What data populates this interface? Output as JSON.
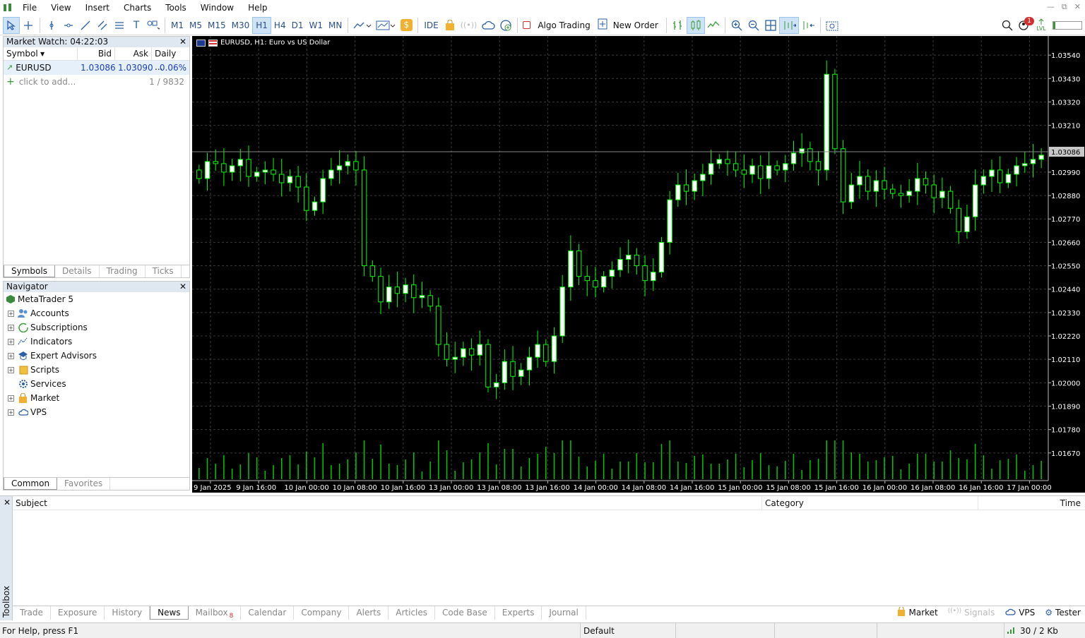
{
  "menu": {
    "items": [
      "File",
      "View",
      "Insert",
      "Charts",
      "Tools",
      "Window",
      "Help"
    ]
  },
  "toolbar": {
    "timeframes": [
      "M1",
      "M5",
      "M15",
      "M30",
      "H1",
      "H4",
      "D1",
      "W1",
      "MN"
    ],
    "active_timeframe": "H1",
    "ide_label": "IDE",
    "algo_trading_label": "Algo Trading",
    "new_order_label": "New Order",
    "alerts_count": "1",
    "lvl_label": "LVL"
  },
  "market_watch": {
    "title": "Market Watch: 04:22:03",
    "columns": [
      "Symbol",
      "Bid",
      "Ask",
      "Daily ..."
    ],
    "rows": [
      {
        "symbol": "EURUSD",
        "bid": "1.03086",
        "ask": "1.03090",
        "daily": "0.06%"
      }
    ],
    "add_label": "click to add...",
    "count_label": "1 / 9832",
    "tabs": [
      "Symbols",
      "Details",
      "Trading",
      "Ticks"
    ],
    "active_tab": "Symbols"
  },
  "navigator": {
    "title": "Navigator",
    "root": "MetaTrader 5",
    "items": [
      {
        "label": "Accounts",
        "icon": "accounts-icon",
        "expandable": true
      },
      {
        "label": "Subscriptions",
        "icon": "subscriptions-icon",
        "expandable": true
      },
      {
        "label": "Indicators",
        "icon": "indicators-icon",
        "expandable": true
      },
      {
        "label": "Expert Advisors",
        "icon": "expert-advisors-icon",
        "expandable": true
      },
      {
        "label": "Scripts",
        "icon": "scripts-icon",
        "expandable": true
      },
      {
        "label": "Services",
        "icon": "services-icon",
        "expandable": false
      },
      {
        "label": "Market",
        "icon": "market-icon",
        "expandable": true
      },
      {
        "label": "VPS",
        "icon": "vps-icon",
        "expandable": true
      }
    ],
    "tabs": [
      "Common",
      "Favorites"
    ],
    "active_tab": "Common"
  },
  "chart": {
    "title": "EURUSD, H1:  Euro vs US Dollar",
    "current_price_label": "1.03086"
  },
  "chart_data": {
    "type": "candlestick",
    "symbol": "EURUSD",
    "timeframe": "H1",
    "current_price": 1.03086,
    "y_ticks": [
      "1.03540",
      "1.03430",
      "1.03320",
      "1.03210",
      "1.02990",
      "1.02880",
      "1.02770",
      "1.02660",
      "1.02550",
      "1.02440",
      "1.02330",
      "1.02220",
      "1.02110",
      "1.02000",
      "1.01890",
      "1.01780",
      "1.01670"
    ],
    "ylim": [
      1.0154,
      1.0363
    ],
    "x_ticks": [
      "9 Jan 2025",
      "9 Jan 16:00",
      "10 Jan 00:00",
      "10 Jan 08:00",
      "10 Jan 16:00",
      "13 Jan 00:00",
      "13 Jan 08:00",
      "13 Jan 16:00",
      "14 Jan 00:00",
      "14 Jan 08:00",
      "14 Jan 16:00",
      "15 Jan 00:00",
      "15 Jan 08:00",
      "15 Jan 16:00",
      "16 Jan 00:00",
      "16 Jan 08:00",
      "16 Jan 16:00",
      "17 Jan 00:00"
    ],
    "closes": [
      1.0296,
      1.0304,
      1.0303,
      1.0299,
      1.0302,
      1.0305,
      1.0297,
      1.0299,
      1.03,
      1.0298,
      1.0294,
      1.0297,
      1.0292,
      1.0281,
      1.0285,
      1.0296,
      1.03,
      1.0302,
      1.0304,
      1.03,
      1.0255,
      1.025,
      1.0238,
      1.0245,
      1.0242,
      1.0246,
      1.024,
      1.0241,
      1.0236,
      1.0218,
      1.0211,
      1.0212,
      1.0216,
      1.0213,
      1.0218,
      1.0198,
      1.02,
      1.021,
      1.0203,
      1.0206,
      1.0212,
      1.0218,
      1.021,
      1.0222,
      1.0245,
      1.0262,
      1.025,
      1.0248,
      1.0245,
      1.025,
      1.0253,
      1.0258,
      1.026,
      1.0255,
      1.0248,
      1.0252,
      1.0266,
      1.0286,
      1.0293,
      1.029,
      1.0295,
      1.0298,
      1.0303,
      1.0305,
      1.0303,
      1.03,
      1.0298,
      1.0302,
      1.0296,
      1.0302,
      1.03,
      1.0303,
      1.0308,
      1.031,
      1.0304,
      1.03,
      1.0345,
      1.031,
      1.0285,
      1.0293,
      1.0297,
      1.029,
      1.0295,
      1.0291,
      1.0289,
      1.0288,
      1.029,
      1.0296,
      1.0293,
      1.0287,
      1.029,
      1.0282,
      1.0271,
      1.0278,
      1.0293,
      1.0297,
      1.03,
      1.0294,
      1.0298,
      1.0302,
      1.0303,
      1.0305,
      1.0307
    ],
    "grid": true,
    "background": "#000000",
    "bull_color": "#ffffff",
    "bear_color": "#000000",
    "wick_color": "#00ff00",
    "volume_color": "#00c800"
  },
  "toolbox": {
    "side_label": "Toolbox",
    "columns": [
      "Subject",
      "Category",
      "Time"
    ],
    "tabs": [
      {
        "label": "Trade"
      },
      {
        "label": "Exposure"
      },
      {
        "label": "History"
      },
      {
        "label": "News"
      },
      {
        "label": "Mailbox",
        "badge": "8"
      },
      {
        "label": "Calendar"
      },
      {
        "label": "Company"
      },
      {
        "label": "Alerts"
      },
      {
        "label": "Articles"
      },
      {
        "label": "Code Base"
      },
      {
        "label": "Experts"
      },
      {
        "label": "Journal"
      }
    ],
    "active_tab": "News",
    "right_items": [
      "Market",
      "Signals",
      "VPS",
      "Tester"
    ]
  },
  "status": {
    "help": "For Help, press F1",
    "profile": "Default",
    "traffic": "30 / 2 Kb"
  }
}
